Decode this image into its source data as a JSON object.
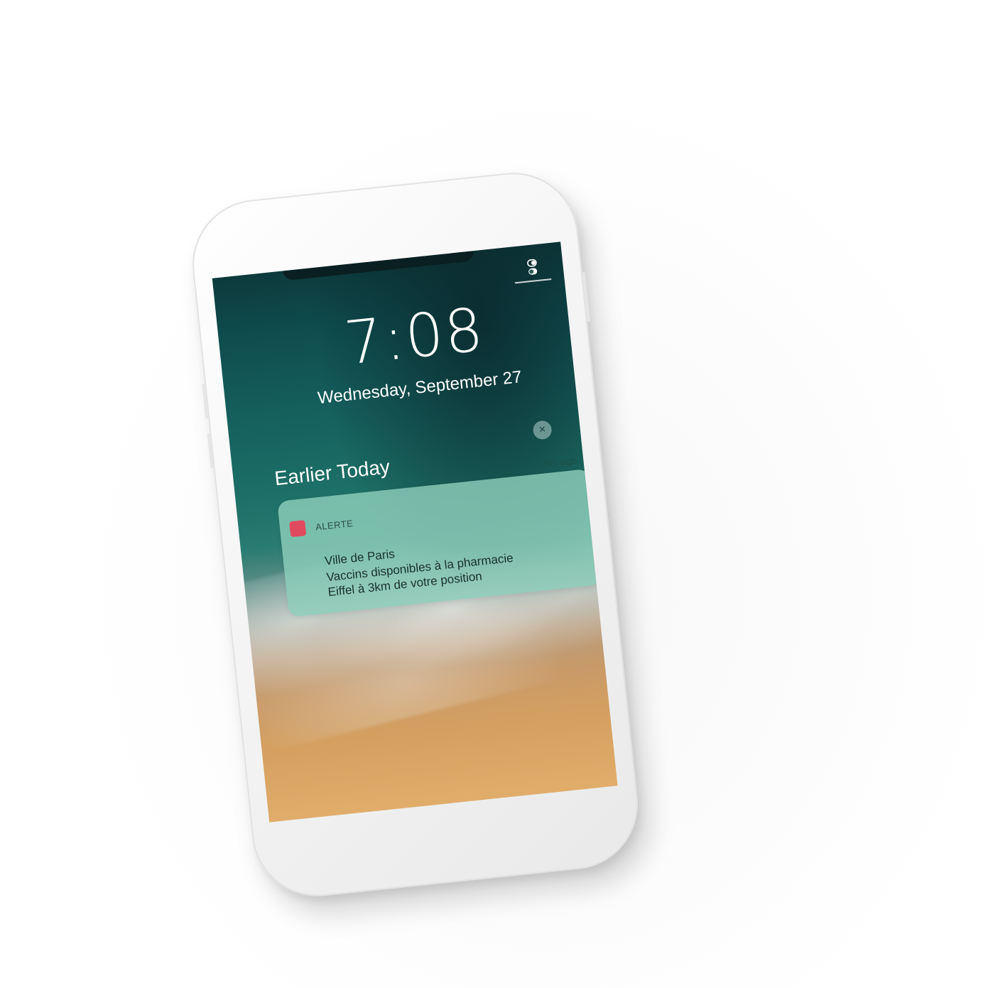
{
  "lockscreen": {
    "time": "7:08",
    "date": "Wednesday, September 27",
    "section_title": "Earlier Today",
    "clear_icon": "×"
  },
  "notification": {
    "app_name": "ALERTE",
    "time_ago": "5m ago",
    "title": "Ville de Paris",
    "message_line1": "Vaccins disponibles à la pharmacie",
    "message_line2": "Eiffel à 3km de votre position",
    "icon_color": "#e04a5e"
  },
  "icons": {
    "control_center": "control-center-icon",
    "clear": "close-icon",
    "app": "app-icon"
  }
}
